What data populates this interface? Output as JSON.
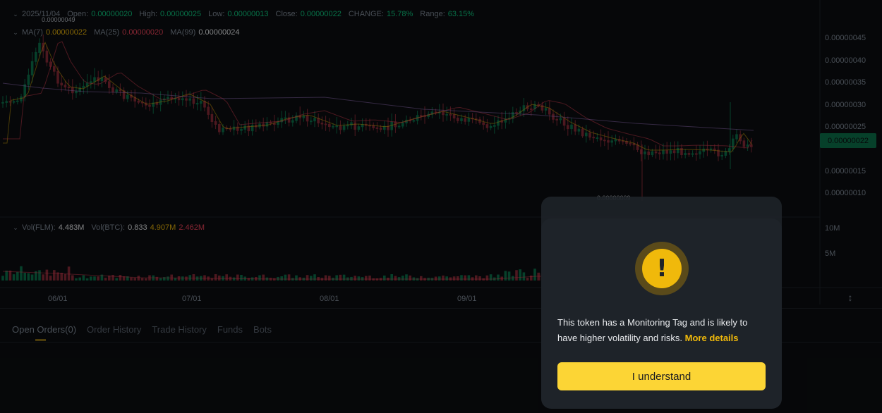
{
  "legend": {
    "date": "2025/11/04",
    "open_label": "Open:",
    "open": "0.00000020",
    "high_label": "High:",
    "high": "0.00000025",
    "low_label": "Low:",
    "low": "0.00000013",
    "close_label": "Close:",
    "close": "0.00000022",
    "change_label": "CHANGE:",
    "change": "15.78%",
    "range_label": "Range:",
    "range": "63.15%"
  },
  "ma": {
    "ma7_label": "MA(7)",
    "ma7": "0.00000022",
    "ma25_label": "MA(25)",
    "ma25": "0.00000020",
    "ma99_label": "MA(99)",
    "ma99": "0.00000024"
  },
  "volume": {
    "flm_label": "Vol(FLM):",
    "flm": "4.483M",
    "btc_label": "Vol(BTC):",
    "btc": "0.833",
    "ma1": "4.907M",
    "ma2": "2.462M"
  },
  "price_axis": [
    "0.00000045",
    "0.00000040",
    "0.00000035",
    "0.00000030",
    "0.00000025",
    "0.00000015",
    "0.00000010"
  ],
  "current_price": "0.00000022",
  "high_marker": "0.00000049",
  "low_marker": "0.00000009",
  "volume_axis": [
    "10M",
    "5M"
  ],
  "time_axis": [
    "06/01",
    "07/01",
    "08/01",
    "09/01"
  ],
  "tabs": [
    {
      "label": "Open Orders(0)"
    },
    {
      "label": "Order History"
    },
    {
      "label": "Trade History"
    },
    {
      "label": "Funds"
    },
    {
      "label": "Bots"
    }
  ],
  "modal": {
    "text": "This token has a Monitoring Tag and is likely to have higher volatility and risks. ",
    "link": "More details",
    "button": "I understand",
    "icon": "exclamation-icon"
  },
  "colors": {
    "up": "#0ecb81",
    "down": "#f6465d",
    "accent": "#fcd535",
    "ma7": "#f0b90b",
    "ma25": "#f6465d",
    "ma99": "#b887e6"
  }
}
